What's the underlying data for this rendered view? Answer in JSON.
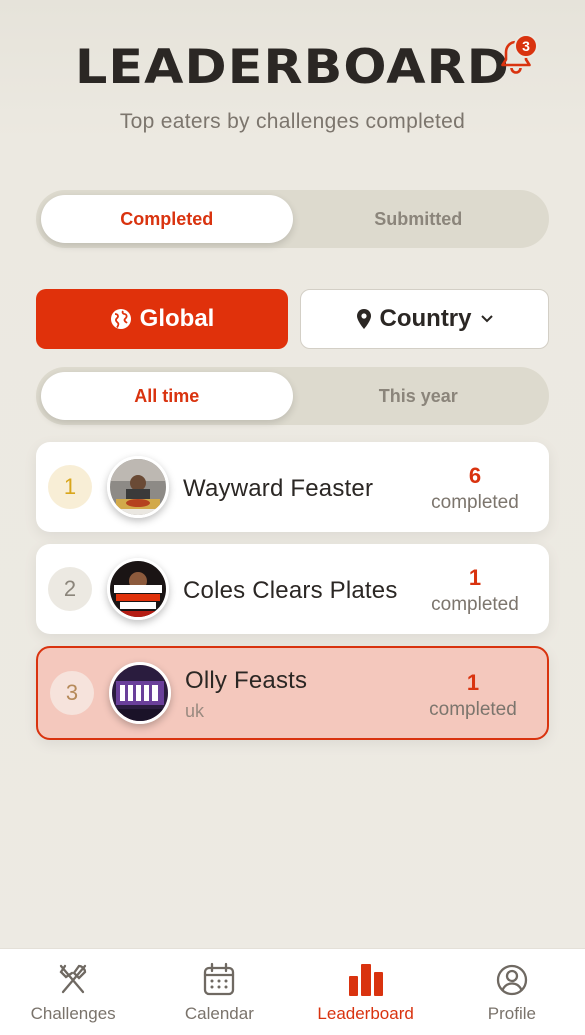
{
  "header": {
    "title": "LEADERBOARD",
    "subtitle": "Top eaters by challenges completed",
    "notification_count": "3"
  },
  "tabs_type": {
    "options": [
      "Completed",
      "Submitted"
    ],
    "selected": "Completed"
  },
  "scope": {
    "global_label": "Global",
    "country_label": "Country",
    "selected": "Global"
  },
  "tabs_period": {
    "options": [
      "All time",
      "This year"
    ],
    "selected": "All time"
  },
  "leaderboard": [
    {
      "rank": "1",
      "name": "Wayward Feaster",
      "location": "",
      "count": "6",
      "count_label": "completed",
      "rank_color": "#d9a61c",
      "rank_bg": "#f8eed6"
    },
    {
      "rank": "2",
      "name": "Coles Clears Plates",
      "location": "",
      "count": "1",
      "count_label": "completed",
      "rank_color": "#8b857b",
      "rank_bg": "#ece9e2"
    },
    {
      "rank": "3",
      "name": "Olly Feasts",
      "location": "uk",
      "count": "1",
      "count_label": "completed",
      "rank_color": "#b68a5a",
      "rank_bg": "#f6e3dc",
      "is_current_user": true
    }
  ],
  "nav": {
    "items": [
      {
        "label": "Challenges",
        "icon": "fork-knife-icon"
      },
      {
        "label": "Calendar",
        "icon": "calendar-icon"
      },
      {
        "label": "Leaderboard",
        "icon": "bar-chart-icon"
      },
      {
        "label": "Profile",
        "icon": "user-circle-icon"
      }
    ],
    "active": "Leaderboard"
  },
  "colors": {
    "accent": "#d9330f",
    "accent_button": "#e0310b",
    "current_user_bg": "#f4c8bd"
  }
}
